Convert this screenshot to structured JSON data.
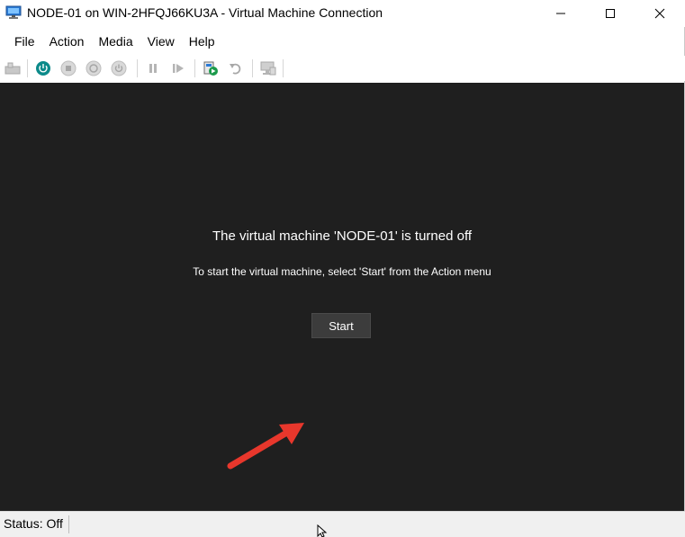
{
  "window": {
    "title": "NODE-01 on WIN-2HFQJ66KU3A - Virtual Machine Connection",
    "icon": "vm-monitor-icon",
    "controls": [
      "minimize-icon",
      "maximize-icon",
      "close-icon"
    ]
  },
  "menu": {
    "items": [
      "File",
      "Action",
      "Media",
      "View",
      "Help"
    ]
  },
  "toolbar": {
    "buttons": [
      "ctrl-alt-del-icon",
      "power-start-icon",
      "turn-off-icon",
      "shutdown-icon",
      "save-icon",
      "pause-icon",
      "resume-icon",
      "checkpoint-icon",
      "revert-icon",
      "enhanced-session-icon"
    ],
    "accent": "#0c8a8a"
  },
  "console": {
    "heading": "The virtual machine 'NODE-01' is turned off",
    "hint": "To start the virtual machine, select 'Start' from the Action menu",
    "start_label": "Start",
    "background": "#1f1f1f",
    "annotation_color": "#e8372c"
  },
  "status": {
    "text": "Status: Off"
  }
}
